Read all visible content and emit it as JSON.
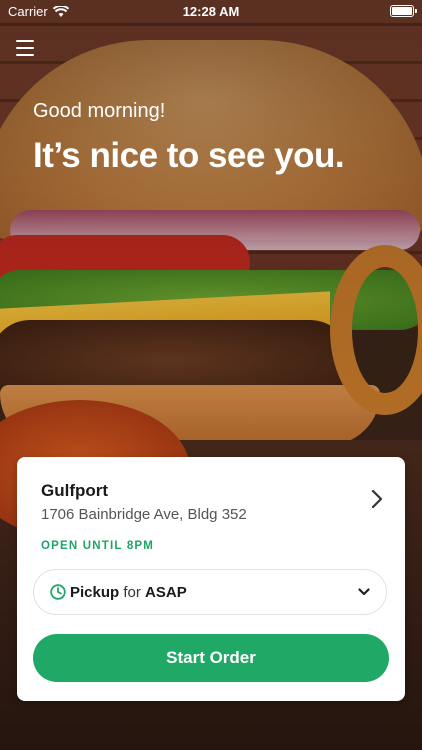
{
  "status_bar": {
    "carrier": "Carrier",
    "time": "12:28 AM",
    "wifi_icon": "wifi-icon",
    "battery_icon": "battery-icon"
  },
  "header": {
    "menu_icon": "hamburger-menu-icon",
    "greeting": "Good morning!",
    "headline": "It’s nice to see you."
  },
  "location": {
    "name": "Gulfport",
    "address": "1706 Bainbridge Ave, Bldg 352",
    "open_status": "OPEN UNTIL 8PM",
    "chevron_icon": "chevron-right-icon"
  },
  "order_mode": {
    "mode": "Pickup",
    "connector": " for ",
    "time": "ASAP",
    "clock_icon": "clock-icon",
    "dropdown_icon": "chevron-down-icon"
  },
  "actions": {
    "start_label": "Start Order"
  },
  "colors": {
    "accent": "#20a866",
    "open_text": "#1ea566"
  }
}
